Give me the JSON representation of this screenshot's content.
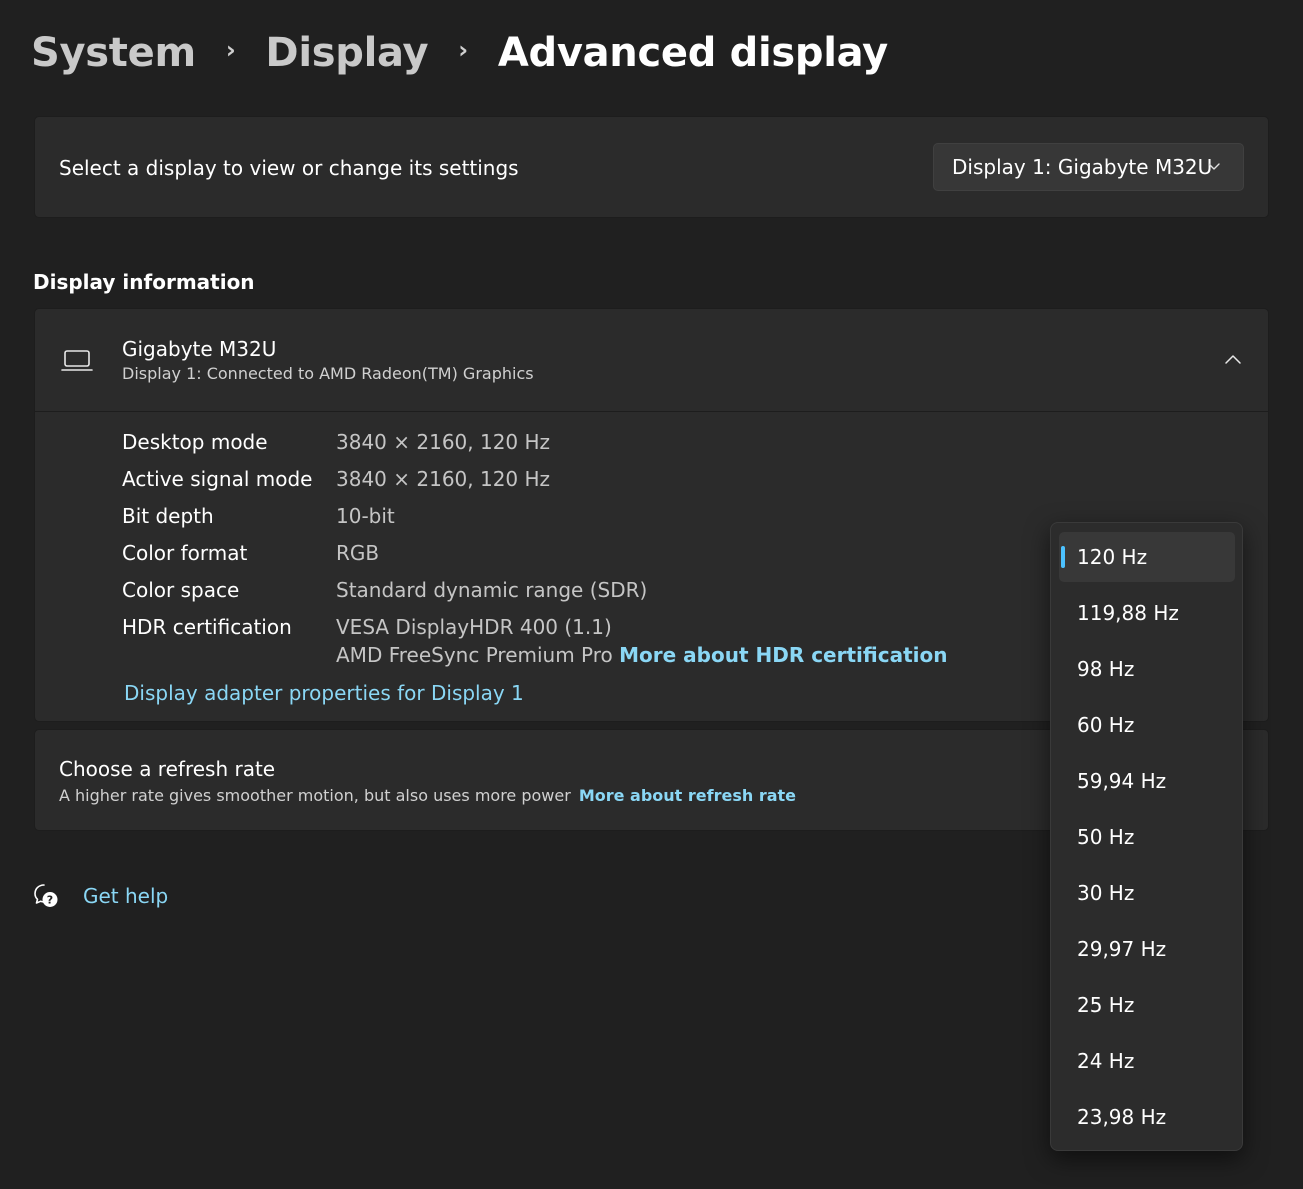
{
  "breadcrumb": {
    "items": [
      "System",
      "Display",
      "Advanced display"
    ]
  },
  "select_display": {
    "label": "Select a display to view or change its settings",
    "selected": "Display 1: Gigabyte M32U"
  },
  "display_info": {
    "heading": "Display information",
    "monitor_name": "Gigabyte M32U",
    "monitor_subtitle": "Display 1: Connected to AMD Radeon(TM) Graphics",
    "rows": [
      {
        "key": "Desktop mode",
        "value": "3840 × 2160, 120 Hz"
      },
      {
        "key": "Active signal mode",
        "value": "3840 × 2160, 120 Hz"
      },
      {
        "key": "Bit depth",
        "value": "10-bit"
      },
      {
        "key": "Color format",
        "value": "RGB"
      },
      {
        "key": "Color space",
        "value": "Standard dynamic range (SDR)"
      },
      {
        "key": "HDR certification",
        "value": "VESA DisplayHDR 400 (1.1)"
      }
    ],
    "hdr_second_line": "AMD FreeSync Premium Pro",
    "hdr_link": "More about HDR certification",
    "adapter_link": "Display adapter properties for Display 1"
  },
  "refresh_rate": {
    "title": "Choose a refresh rate",
    "subtitle": "A higher rate gives smoother motion, but also uses more power",
    "link": "More about refresh rate",
    "options": [
      "120 Hz",
      "119,88 Hz",
      "98 Hz",
      "60 Hz",
      "59,94 Hz",
      "50 Hz",
      "30 Hz",
      "29,97 Hz",
      "25 Hz",
      "24 Hz",
      "23,98 Hz"
    ],
    "selected": "120 Hz"
  },
  "help": {
    "label": "Get help"
  },
  "colors": {
    "background": "#202020",
    "card": "#2b2b2b",
    "accent": "#4cc2ff",
    "link": "#8ad7f5"
  },
  "icons": [
    "chevron-right-icon",
    "chevron-down-icon",
    "laptop-icon",
    "chevron-up-icon",
    "get-help-icon"
  ]
}
